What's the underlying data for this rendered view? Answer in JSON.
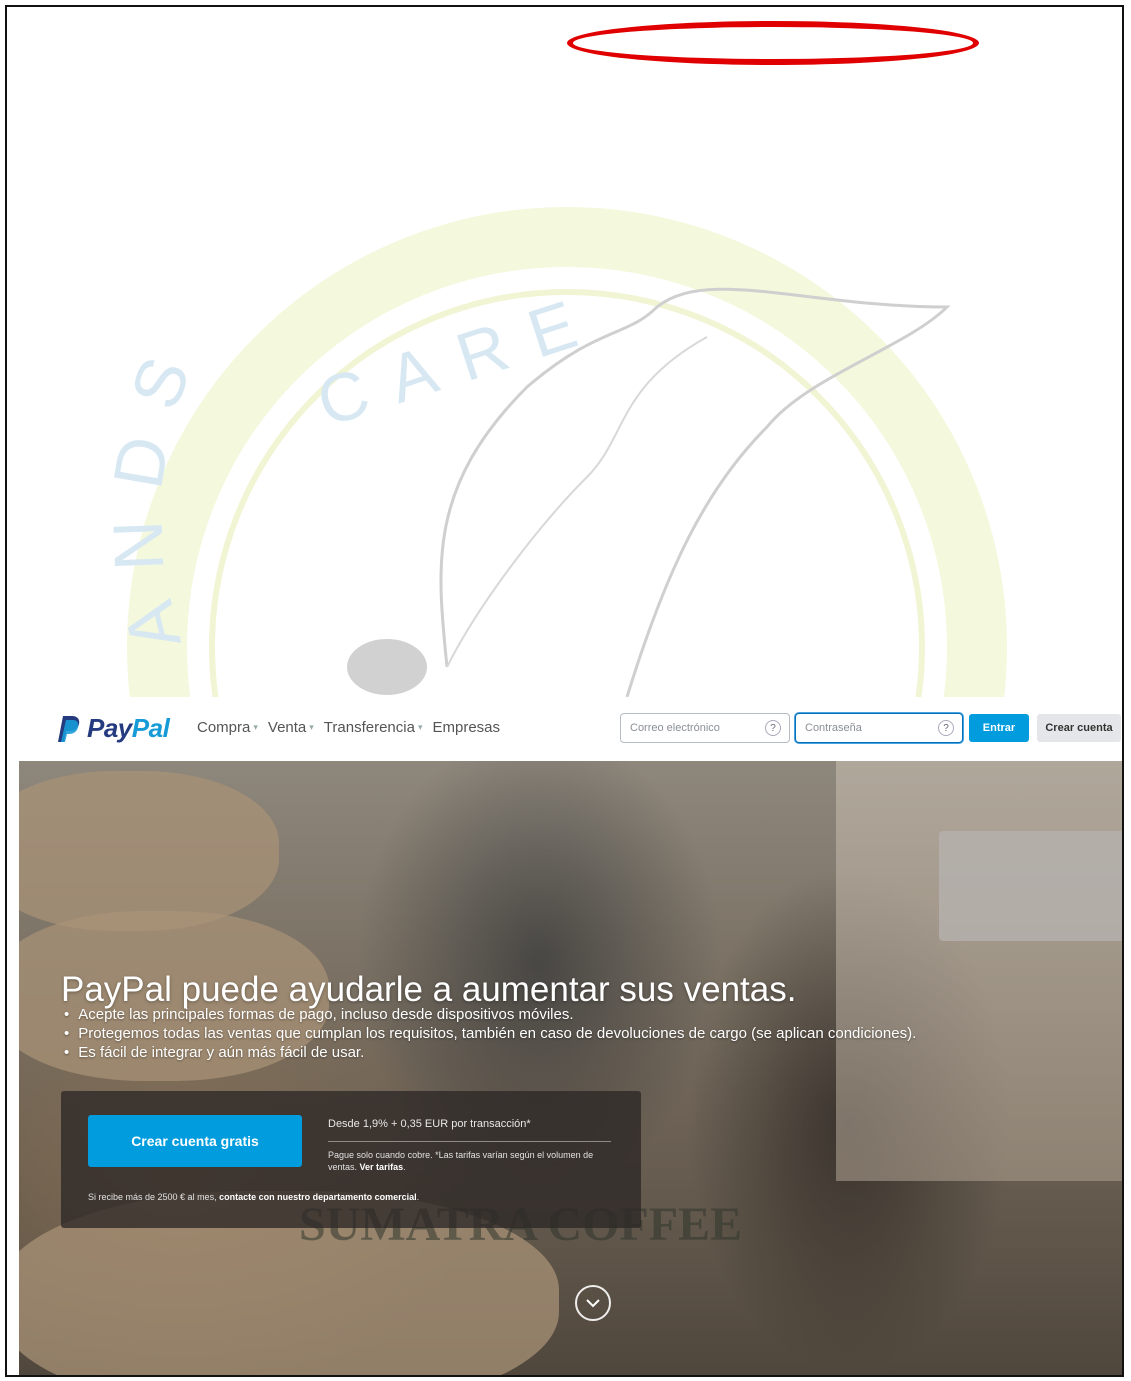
{
  "watermark": {
    "text": "CARE",
    "partial_text": "ANDS"
  },
  "brand": {
    "word_pay": "Pay",
    "word_pal": "Pal",
    "primary_color": "#253b80",
    "accent_color": "#179bd7",
    "button_color": "#009cde"
  },
  "nav": {
    "menu": [
      {
        "label": "Compra",
        "has_caret": true
      },
      {
        "label": "Venta",
        "has_caret": true
      },
      {
        "label": "Transferencia",
        "has_caret": true
      },
      {
        "label": "Empresas",
        "has_caret": false
      }
    ],
    "email_placeholder": "Correo electrónico",
    "password_placeholder": "Contraseña",
    "help_glyph": "?",
    "login_button": "Entrar",
    "signup_button": "Crear cuenta"
  },
  "hero": {
    "headline": "PayPal puede ayudarle a aumentar sus ventas.",
    "bullets": [
      "Acepte las principales formas de pago, incluso desde dispositivos móviles.",
      "Protegemos todas las ventas que cumplan los requisitos, también en caso de devoluciones de cargo (se aplican condiciones).",
      "Es fácil de integrar y aún más fácil de usar."
    ],
    "cta_button": "Crear cuenta gratis",
    "fee_text": "Desde 1,9% + 0,35 EUR por transacción*",
    "note_text": "Pague solo cuando cobre. *Las tarifas varían según el volumen de ventas.",
    "note_link": "Ver tarifas",
    "contact_text": "Si recibe más de 2500 € al mes,",
    "contact_link": "contacte con nuestro departamento comercial",
    "background_text": "SUMATRA COFFEE"
  }
}
